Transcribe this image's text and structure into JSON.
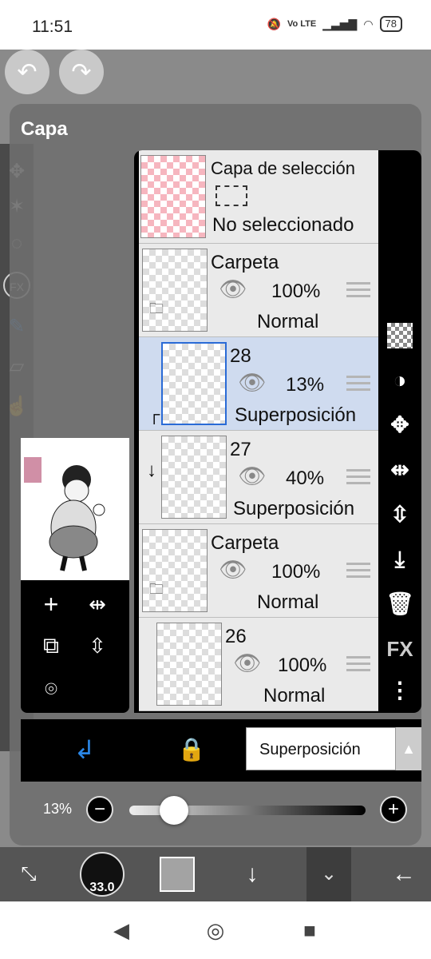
{
  "status_bar": {
    "time": "11:51",
    "network_label": "Vo LTE",
    "battery": "78"
  },
  "dialog": {
    "title": "Capa"
  },
  "layers": [
    {
      "name": "Capa de selección",
      "status": "No seleccionado",
      "type": "selection"
    },
    {
      "name": "Carpeta",
      "opacity": "100%",
      "blend": "Normal",
      "type": "folder"
    },
    {
      "name": "28",
      "opacity": "13%",
      "blend": "Superposición",
      "type": "layer",
      "selected": true,
      "clipped": true
    },
    {
      "name": "27",
      "opacity": "40%",
      "blend": "Superposición",
      "type": "layer",
      "clipped": true
    },
    {
      "name": "Carpeta",
      "opacity": "100%",
      "blend": "Normal",
      "type": "folder"
    },
    {
      "name": "26",
      "opacity": "100%",
      "blend": "Normal",
      "type": "layer"
    }
  ],
  "controls": {
    "blend_mode": "Superposición",
    "opacity_value": "13%",
    "opacity_fraction": 0.13
  },
  "right_toolbar": {
    "fx_label": "FX"
  },
  "left_tools": {
    "fx_label": "FX"
  },
  "bottom_toolbar": {
    "brush_size": "33.0",
    "color_swatch": "#a3a3a3"
  },
  "colors": {
    "selected_row": "#cfdbef",
    "accent_blue": "#2a86e6"
  }
}
